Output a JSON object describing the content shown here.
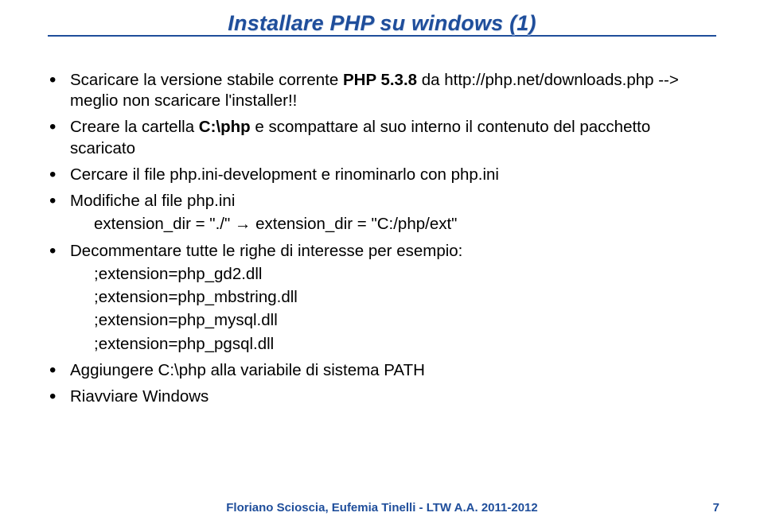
{
  "title": "Installare PHP su windows (1)",
  "bullets": [
    {
      "parts": [
        {
          "t": "Scaricare la versione stabile corrente "
        },
        {
          "t": "PHP 5.3.8",
          "bold": true
        },
        {
          "t": " da http://php.net/downloads.php --> meglio non scaricare l'installer!!"
        }
      ]
    },
    {
      "parts": [
        {
          "t": "Creare la cartella "
        },
        {
          "t": "C:\\php",
          "bold": true
        },
        {
          "t": " e scompattare al suo interno il contenuto del pacchetto scaricato"
        }
      ]
    },
    {
      "parts": [
        {
          "t": "Cercare il file php.ini-development e rinominarlo con php.ini"
        }
      ]
    },
    {
      "parts": [
        {
          "t": "Modifiche al file php.ini"
        }
      ],
      "subs": [
        "extension_dir = \"./\" → extension_dir = \"C:/php/ext\""
      ]
    },
    {
      "parts": [
        {
          "t": "Decommentare tutte le righe di interesse per esempio:"
        }
      ],
      "subs": [
        ";extension=php_gd2.dll",
        ";extension=php_mbstring.dll",
        ";extension=php_mysql.dll",
        ";extension=php_pgsql.dll"
      ]
    },
    {
      "parts": [
        {
          "t": "Aggiungere C:\\php alla variabile di sistema PATH"
        }
      ]
    },
    {
      "parts": [
        {
          "t": "Riavviare Windows"
        }
      ]
    }
  ],
  "footer": "Floriano Scioscia, Eufemia Tinelli - LTW A.A. 2011-2012",
  "page": "7"
}
